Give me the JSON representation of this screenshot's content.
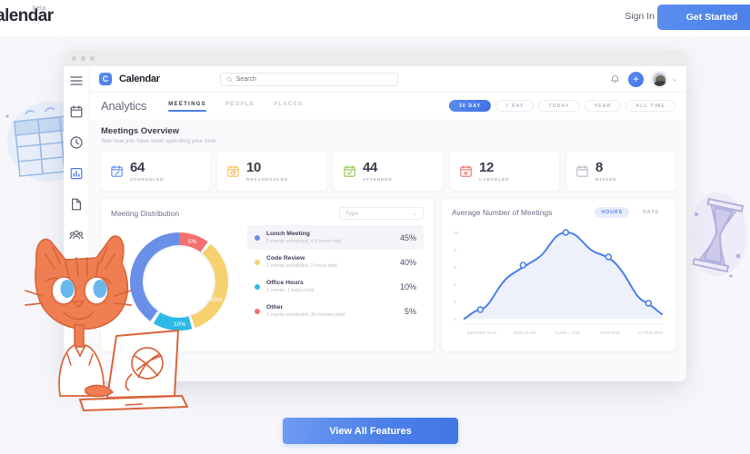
{
  "site_nav": {
    "brand": "Calendar",
    "brand_badge": "beta",
    "sign_in": "Sign In",
    "get_started": "Get Started"
  },
  "window": {
    "sidebar": {
      "items": [
        {
          "icon": "hamburger-menu-icon",
          "active": false
        },
        {
          "icon": "calendar-icon",
          "active": false
        },
        {
          "icon": "clock-icon",
          "active": false
        },
        {
          "icon": "bar-chart-icon",
          "active": true
        },
        {
          "icon": "document-icon",
          "active": false
        },
        {
          "icon": "people-group-icon",
          "active": false
        }
      ]
    },
    "topbar": {
      "logo_mark": "C",
      "logo_text": "Calendar",
      "search_placeholder": "Search",
      "search_value": "",
      "notification_icon": "bell-icon",
      "add_icon": "plus-icon",
      "avatar_chevron": "⌄"
    },
    "analytics": {
      "title": "Analytics",
      "tabs": [
        {
          "label": "MEETINGS",
          "active": true
        },
        {
          "label": "PEOPLE",
          "active": false
        },
        {
          "label": "PLACES",
          "active": false
        }
      ],
      "ranges": [
        {
          "label": "30 DAY",
          "active": true
        },
        {
          "label": "7 DAY",
          "active": false
        },
        {
          "label": "TODAY",
          "active": false
        },
        {
          "label": "YEAR",
          "active": false
        },
        {
          "label": "ALL TIME",
          "active": false
        }
      ]
    },
    "overview": {
      "title": "Meetings Overview",
      "subtitle": "See how you have been spending your time.",
      "stats": [
        {
          "value": "64",
          "label": "SCHEDULED",
          "icon": "calendar-edit-icon",
          "color": "#5b8def"
        },
        {
          "value": "10",
          "label": "RESCHEDULED",
          "icon": "calendar-refresh-icon",
          "color": "#f5c35c"
        },
        {
          "value": "44",
          "label": "ATTENDED",
          "icon": "calendar-check-icon",
          "color": "#8cc84b"
        },
        {
          "value": "12",
          "label": "CANCELED",
          "icon": "calendar-close-icon",
          "color": "#f4706e"
        },
        {
          "value": "8",
          "label": "MISSED",
          "icon": "calendar-blank-icon",
          "color": "#b9b9c8"
        }
      ]
    },
    "distribution": {
      "title": "Meeting Distribution",
      "filter_label": "Type",
      "filter_chevron": "⌄",
      "chart_data": {
        "type": "pie",
        "title": "Meeting Distribution",
        "categories": [
          "Lunch Meeting",
          "Code Review",
          "Office Hours",
          "Other"
        ],
        "values": [
          45,
          40,
          10,
          5
        ],
        "labels": [
          "45%",
          "40%",
          "10%",
          "5%"
        ],
        "colors": [
          "#6a8fe8",
          "#f7d06f",
          "#2eb9e6",
          "#f4706e"
        ],
        "legend_position": "right"
      },
      "legend": [
        {
          "name": "Lunch Meeting",
          "meta": "5 events scheduled, 4.5 hours total",
          "pct": "45%",
          "color": "#6a8fe8",
          "highlight": true
        },
        {
          "name": "Code Review",
          "meta": "1 events scheduled, 2 hours total",
          "pct": "40%",
          "color": "#f7d06f",
          "highlight": false
        },
        {
          "name": "Office Hours",
          "meta": "1 events, 1 hours total",
          "pct": "10%",
          "color": "#2eb9e6",
          "highlight": false
        },
        {
          "name": "Other",
          "meta": "1 events scheduled, 30 minutes total",
          "pct": "5%",
          "color": "#f4706e",
          "highlight": false
        }
      ]
    },
    "average_meetings": {
      "title": "Average Number of Meetings",
      "toggle": [
        {
          "label": "HOURS",
          "active": true
        },
        {
          "label": "DAYS",
          "active": false
        }
      ],
      "chart_data": {
        "type": "area",
        "title": "Average Number of Meetings",
        "categories": [
          "BEFORE 9AM",
          "9AM-11AM",
          "11AM - 1PM",
          "1PM-5PM",
          "AFTER 5PM"
        ],
        "values": [
          1,
          6,
          10,
          8,
          3
        ],
        "xlabel": "",
        "ylabel": "",
        "ylim": [
          0,
          10
        ],
        "yticks": [
          "0",
          "2",
          "4",
          "6",
          "8",
          "10"
        ],
        "line_color": "#4a7fe8",
        "fill_color": "#eaeffc",
        "grid": false
      }
    }
  },
  "cta": {
    "label": "View All Features"
  },
  "decorations": [
    {
      "name": "calendar-doodle",
      "color": "#a8c3ea"
    },
    {
      "name": "hourglass-doodle",
      "color": "#c0bfe4"
    },
    {
      "name": "cat-mascot-illustration",
      "color": "#ef7f52"
    }
  ]
}
